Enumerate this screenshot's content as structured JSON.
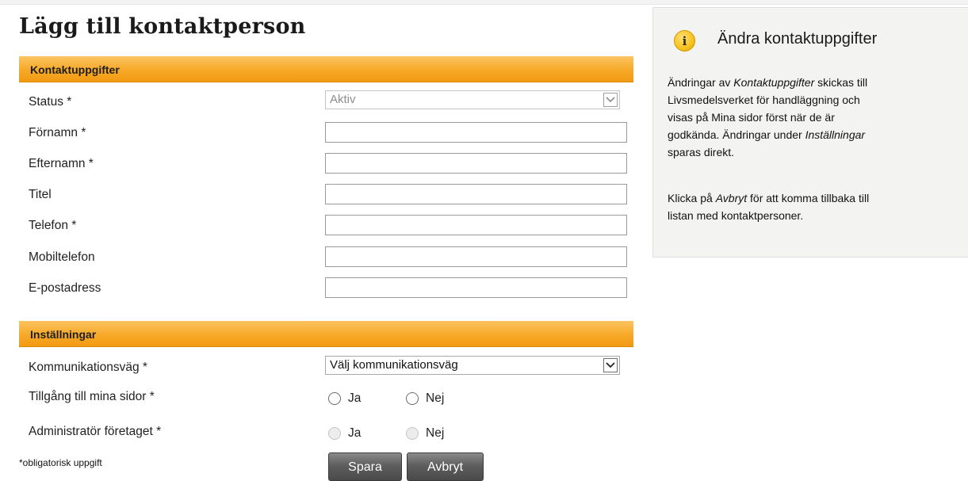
{
  "page": {
    "title": "Lägg till kontaktperson"
  },
  "sections": {
    "contact": {
      "header": "Kontaktuppgifter"
    },
    "settings": {
      "header": "Inställningar"
    }
  },
  "form": {
    "status": {
      "label": "Status *",
      "value": "Aktiv",
      "disabled": true
    },
    "firstname": {
      "label": "Förnamn *",
      "value": ""
    },
    "lastname": {
      "label": "Efternamn *",
      "value": ""
    },
    "title": {
      "label": "Titel",
      "value": ""
    },
    "phone": {
      "label": "Telefon *",
      "value": ""
    },
    "mobile": {
      "label": "Mobiltelefon",
      "value": ""
    },
    "email": {
      "label": "E-postadress",
      "value": ""
    },
    "communication": {
      "label": "Kommunikationsväg *",
      "value": "Välj kommunikationsväg"
    },
    "access": {
      "label": "Tillgång till mina sidor *",
      "yes": "Ja",
      "no": "Nej"
    },
    "admin": {
      "label": "Administratör företaget *",
      "yes": "Ja",
      "no": "Nej",
      "disabled": true
    }
  },
  "footer": {
    "required_note": "*obligatorisk uppgift",
    "save_label": "Spara",
    "cancel_label": "Avbryt"
  },
  "info": {
    "icon": "info-icon",
    "icon_glyph": "i",
    "title": "Ändra kontaktuppgifter",
    "p1": [
      {
        "t": "Ändringar av ",
        "em": false
      },
      {
        "t": "Kontaktuppgifter",
        "em": true
      },
      {
        "t": " skickas till",
        "em": false
      },
      {
        "t": "Livsmedelsverket för handläggning och",
        "em": false
      },
      {
        "t": "visas på Mina sidor först när de är",
        "em": false
      },
      {
        "t": "godkända. Ändringar under ",
        "em": false
      },
      {
        "t": "Inställningar",
        "em": true
      },
      {
        "t": "sparas direkt.",
        "em": false
      }
    ],
    "p2": [
      {
        "t": "Klicka på ",
        "em": false
      },
      {
        "t": "Avbryt",
        "em": true
      },
      {
        "t": " för att komma tillbaka till",
        "em": false
      },
      {
        "t": "listan med kontaktpersoner.",
        "em": false
      }
    ]
  },
  "colors": {
    "section_header": "#f7a928",
    "button": "#5e5e5e",
    "info_panel": "#f3f3f2",
    "info_icon": "#f7c21c"
  }
}
